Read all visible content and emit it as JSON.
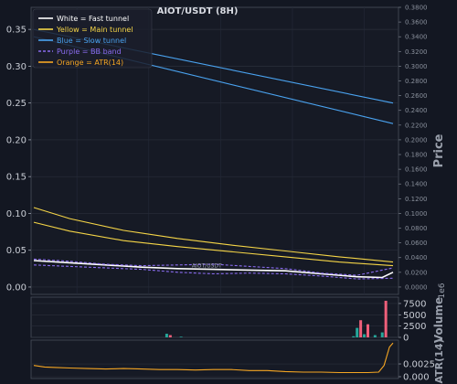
{
  "chart_data": {
    "type": "line",
    "title": "AIOT/USDT (8H)",
    "legend": {
      "placement": "top-left",
      "entries": [
        {
          "label": "White = Fast tunnel",
          "color": "#ffffff",
          "style": "solid"
        },
        {
          "label": "Yellow = Main tunnel",
          "color": "#f5d547",
          "style": "solid"
        },
        {
          "label": "Blue = Slow tunnel",
          "color": "#4aa3f0",
          "style": "solid"
        },
        {
          "label": "Purple = BB band",
          "color": "#8a6cf0",
          "style": "dashed"
        },
        {
          "label": "Orange = ATR(14)",
          "color": "#f5a623",
          "style": "solid"
        }
      ]
    },
    "price_panel": {
      "ylabel_right": "Price",
      "ylim": [
        -0.01,
        0.38
      ],
      "left_ticks": [
        0.0,
        0.05,
        0.1,
        0.15,
        0.2,
        0.25,
        0.3,
        0.35
      ],
      "left_tick_labels": [
        "0.00",
        "0.05",
        "0.10",
        "0.15",
        "0.20",
        "0.25",
        "0.30",
        "0.35"
      ],
      "right_ticks": [
        0.0,
        0.02,
        0.04,
        0.06,
        0.08,
        0.1,
        0.12,
        0.14,
        0.16,
        0.18,
        0.2,
        0.22,
        0.24,
        0.26,
        0.28,
        0.3,
        0.32,
        0.34,
        0.36,
        0.38
      ],
      "right_tick_labels": [
        "0.0000",
        "0.0200",
        "0.0400",
        "0.0600",
        "0.0800",
        "0.1000",
        "0.1200",
        "0.1400",
        "0.1600",
        "0.1800",
        "0.2000",
        "0.2200",
        "0.2400",
        "0.2600",
        "0.2800",
        "0.3000",
        "0.3200",
        "0.3400",
        "0.3600",
        "0.3800"
      ],
      "x_range": [
        0,
        100
      ],
      "series": [
        {
          "color": "#4aa3f0",
          "x": [
            0,
            100
          ],
          "y": [
            0.35,
            0.25
          ]
        },
        {
          "color": "#4aa3f0",
          "x": [
            0,
            100
          ],
          "y": [
            0.34,
            0.222
          ]
        },
        {
          "color": "#f5d547",
          "x": [
            0,
            10,
            25,
            40,
            55,
            70,
            85,
            100
          ],
          "y": [
            0.108,
            0.093,
            0.077,
            0.066,
            0.057,
            0.049,
            0.041,
            0.034
          ]
        },
        {
          "color": "#f5d547",
          "x": [
            0,
            10,
            25,
            40,
            55,
            70,
            85,
            100
          ],
          "y": [
            0.088,
            0.076,
            0.063,
            0.055,
            0.048,
            0.041,
            0.034,
            0.029
          ]
        },
        {
          "color": "#ffffff",
          "x": [
            0,
            10,
            20,
            30,
            40,
            50,
            60,
            70,
            80,
            90,
            97,
            100
          ],
          "y": [
            0.036,
            0.033,
            0.03,
            0.027,
            0.025,
            0.024,
            0.023,
            0.022,
            0.018,
            0.014,
            0.013,
            0.02
          ]
        },
        {
          "color": "#8a6cf0",
          "style": "dashed",
          "x": [
            0,
            10,
            20,
            30,
            40,
            50,
            60,
            70,
            80,
            90,
            100
          ],
          "y": [
            0.038,
            0.035,
            0.031,
            0.029,
            0.03,
            0.031,
            0.028,
            0.025,
            0.019,
            0.016,
            0.026
          ]
        },
        {
          "color": "#8a6cf0",
          "style": "dashed",
          "x": [
            0,
            10,
            20,
            30,
            40,
            50,
            60,
            70,
            80,
            90,
            100
          ],
          "y": [
            0.03,
            0.028,
            0.026,
            0.024,
            0.02,
            0.018,
            0.019,
            0.018,
            0.015,
            0.011,
            0.012
          ]
        }
      ],
      "price_tag": {
        "text": "AIOT/USDT",
        "x": 44,
        "y": 0.024
      }
    },
    "volume_panel": {
      "ylabel_right": "Volume",
      "scale_note": "1e6",
      "ylim": [
        0,
        8500
      ],
      "right_ticks": [
        0,
        2500,
        5000,
        7500
      ],
      "right_tick_labels": [
        "0",
        "2500",
        "5000",
        "7500"
      ],
      "bars": [
        {
          "x": 37,
          "value": 800,
          "color": "#26a69a"
        },
        {
          "x": 38,
          "value": 500,
          "color": "#ef5f7a"
        },
        {
          "x": 41,
          "value": 150,
          "color": "#26a69a"
        },
        {
          "x": 89,
          "value": 250,
          "color": "#26a69a"
        },
        {
          "x": 90,
          "value": 2100,
          "color": "#26a69a"
        },
        {
          "x": 91,
          "value": 3800,
          "color": "#ef5f7a"
        },
        {
          "x": 92,
          "value": 700,
          "color": "#26a69a"
        },
        {
          "x": 93,
          "value": 2900,
          "color": "#ef5f7a"
        },
        {
          "x": 95,
          "value": 500,
          "color": "#26a69a"
        },
        {
          "x": 97,
          "value": 1100,
          "color": "#26a69a"
        },
        {
          "x": 98,
          "value": 8100,
          "color": "#ef5f7a"
        }
      ]
    },
    "atr_panel": {
      "ylabel_right": "ATR(14)",
      "ylim": [
        0.0,
        0.0068
      ],
      "right_ticks": [
        0.0,
        0.0025
      ],
      "right_tick_labels": [
        "0.000",
        "0.0025"
      ],
      "series": [
        {
          "color": "#f5a623",
          "x": [
            0,
            3,
            6,
            10,
            15,
            20,
            25,
            30,
            35,
            40,
            45,
            50,
            55,
            60,
            65,
            70,
            75,
            80,
            85,
            90,
            93,
            96,
            97.5,
            99,
            100
          ],
          "y": [
            0.0022,
            0.0019,
            0.0018,
            0.0017,
            0.0016,
            0.0015,
            0.0016,
            0.0015,
            0.0014,
            0.0014,
            0.0013,
            0.0014,
            0.0014,
            0.0012,
            0.0012,
            0.001,
            0.0009,
            0.0009,
            0.0008,
            0.0008,
            0.0008,
            0.0009,
            0.0022,
            0.0058,
            0.0066
          ]
        }
      ]
    }
  }
}
